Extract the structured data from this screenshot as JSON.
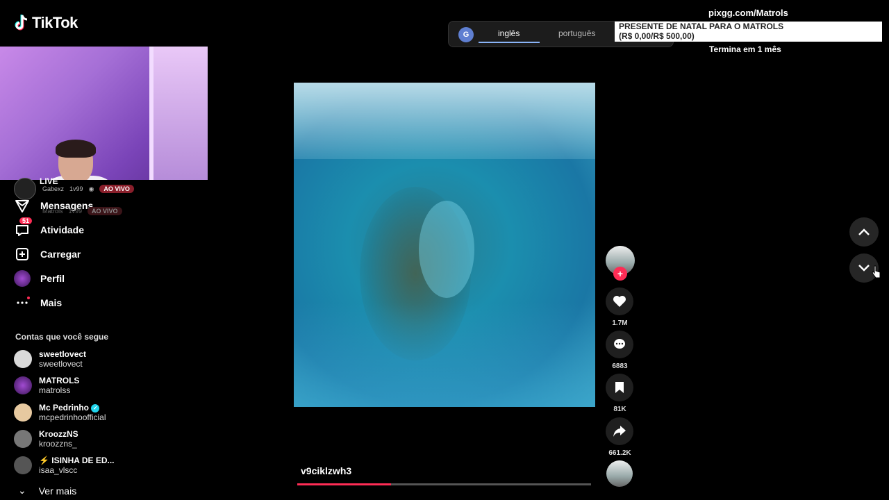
{
  "app": {
    "logo_text": "TikTok"
  },
  "live": {
    "label": "LIVE",
    "rows": [
      {
        "name": "Gabexz",
        "viewers": "1v99",
        "badge": "AO VIVO"
      },
      {
        "name": "Matrols",
        "viewers": "1v99",
        "badge": "AO VIVO"
      }
    ]
  },
  "nav": {
    "messages": "Mensagens",
    "activity": "Atividade",
    "activity_badge": "51",
    "upload": "Carregar",
    "profile": "Perfil",
    "more": "Mais"
  },
  "following": {
    "title": "Contas que você segue",
    "accounts": [
      {
        "name": "sweetlovect",
        "handle": "sweetlovect",
        "color": "#d9d9d9"
      },
      {
        "name": "MATROLS",
        "handle": "matrolss",
        "color": "#6b2b8a"
      },
      {
        "name": "Mc Pedrinho",
        "handle": "mcpedrinhoofficial",
        "color": "#e7c9a0",
        "verified": true
      },
      {
        "name": "KroozzNS",
        "handle": "kroozzns_",
        "color": "#777777"
      },
      {
        "name": "⚡ ISINHA DE ED...",
        "handle": "isaa_vlscc",
        "color": "#555555"
      }
    ],
    "see_more": "Ver mais"
  },
  "translate": {
    "tabs": [
      "inglês",
      "português"
    ],
    "active": "inglês"
  },
  "promo": {
    "site": "pixgg.com/Matrols",
    "line1": "PRESENTE DE NATAL PARA O MATROLS",
    "line2": "(R$ 0,00/R$ 500,00)",
    "ends": "Termina em 1 mês"
  },
  "video": {
    "caption": "v9ciklzwh3",
    "progress": 0.32
  },
  "actions": {
    "likes": "1.7M",
    "comments": "6883",
    "saves": "81K",
    "shares": "661.2K"
  },
  "colors": {
    "accent": "#fe2c55",
    "verified": "#20d5ec"
  }
}
